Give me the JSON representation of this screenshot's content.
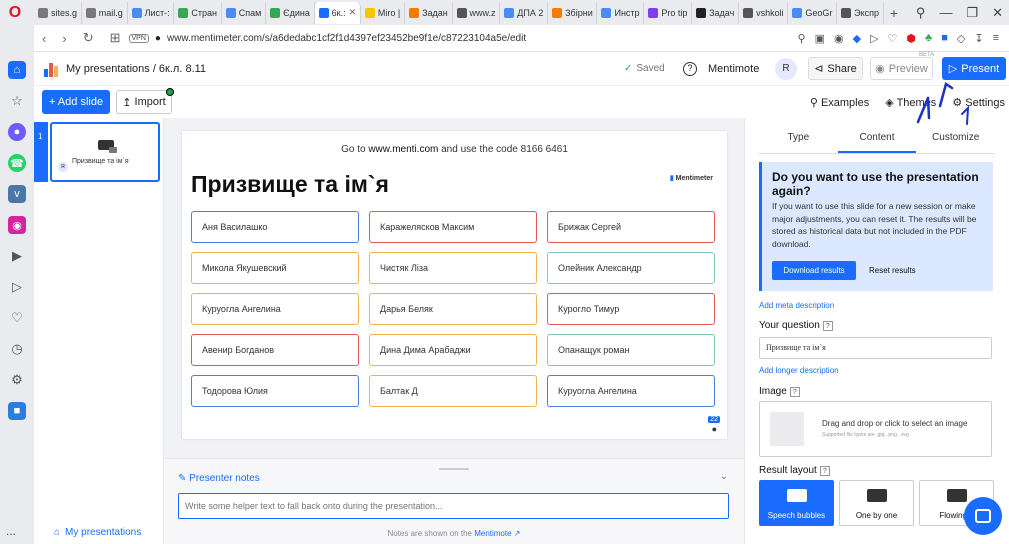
{
  "browser": {
    "tabs": [
      {
        "label": "sites.g",
        "color": "#7a7a7a"
      },
      {
        "label": "mail.g",
        "color": "#7a7a7a"
      },
      {
        "label": "Лист-:",
        "color": "#4c8bf5"
      },
      {
        "label": "Стран",
        "color": "#34a853"
      },
      {
        "label": "Спам",
        "color": "#4c8bf5"
      },
      {
        "label": "Єдина",
        "color": "#34a853"
      },
      {
        "label": "6к.:",
        "color": "#196cff",
        "active": true
      },
      {
        "label": "Miro |",
        "color": "#f7c500"
      },
      {
        "label": "Задан",
        "color": "#f57c00"
      },
      {
        "label": "www.z",
        "color": "#555"
      },
      {
        "label": "ДПА 2",
        "color": "#4c8bf5"
      },
      {
        "label": "Збірни",
        "color": "#f57c00"
      },
      {
        "label": "Инстр",
        "color": "#4c8bf5"
      },
      {
        "label": "Pro tip",
        "color": "#7e3ff2"
      },
      {
        "label": "Задач",
        "color": "#222"
      },
      {
        "label": "vshkoli",
        "color": "#555"
      },
      {
        "label": "GeoGr",
        "color": "#4c8bf5"
      },
      {
        "label": "Экспр",
        "color": "#555"
      }
    ],
    "new_tab": "+",
    "url": "www.mentimeter.com/s/a6dedabc1cf2f1d4397ef23452be9f1e/c87223104a5e/edit",
    "vpn": "VPN"
  },
  "header": {
    "breadcrumb": "My presentations / 6к.л. 8.11",
    "saved": "Saved",
    "mentimote": "Mentimote",
    "avatar": "R",
    "share": "Share",
    "preview": "Preview",
    "beta": "BETA",
    "present": "Present"
  },
  "toolbar": {
    "add_slide": "+ Add slide",
    "import": "Import",
    "examples": "Examples",
    "themes": "Themes",
    "settings": "Settings"
  },
  "slidelist": {
    "thumb_number": "1",
    "thumb_label": "Призвище та ім`я",
    "thumb_avatar": "R",
    "my_presentations": "My presentations",
    "more": "..."
  },
  "slide": {
    "join_prefix": "Go to ",
    "join_site": "www.menti.com",
    "join_middle": " and use the code ",
    "join_code": "8166 6461",
    "title": "Призвище та ім`я",
    "brand": "Mentimeter",
    "counter": "22",
    "responses": [
      {
        "text": "Аня Василашко",
        "color": "#4a7fe0"
      },
      {
        "text": "Каражелясков Максим",
        "color": "#e05a5a"
      },
      {
        "text": "Брижак Сергей",
        "color": "#e05a5a"
      },
      {
        "text": "Микола Якушевский",
        "color": "#f2b24c"
      },
      {
        "text": "Чистяк Ліза",
        "color": "#f2b24c"
      },
      {
        "text": "Олейник Александр",
        "color": "#7cc8b8"
      },
      {
        "text": "Куруогла Ангелина",
        "color": "#f2b24c"
      },
      {
        "text": "Дарья Беляк",
        "color": "#f2b24c"
      },
      {
        "text": "Курогло Тимур",
        "color": "#e05a5a"
      },
      {
        "text": "Авенир Богданов",
        "color": "#e05a5a"
      },
      {
        "text": "Дина Дима Арабаджи",
        "color": "#f2b24c"
      },
      {
        "text": "Опанащук роман",
        "color": "#7cc8b8"
      },
      {
        "text": "Тодорова Юлия",
        "color": "#4a7fe0"
      },
      {
        "text": "Балтак Д",
        "color": "#f2b24c"
      },
      {
        "text": "Куруогла Ангелина",
        "color": "#4a7fe0"
      }
    ]
  },
  "notes": {
    "header": "Presenter notes",
    "placeholder": "Write some helper text to fall back onto during the presentation...",
    "footer_prefix": "Notes are shown on the ",
    "footer_link": "Mentimote"
  },
  "panel": {
    "tabs": [
      "Type",
      "Content",
      "Customize"
    ],
    "reset_title": "Do you want to use the presentation again?",
    "reset_text": "If you want to use this slide for a new session or make major adjustments, you can reset it. The results will be stored as historical data but not included in the PDF download.",
    "download_results": "Download results",
    "reset_results": "Reset results",
    "add_meta": "Add meta description",
    "your_question": "Your question",
    "question_value": "Призвище та ім`я",
    "add_longer": "Add longer description",
    "image": "Image",
    "image_drop": "Drag and drop or click to select an image",
    "image_types": "Supported file types are .jpg, .png, .svg",
    "result_layout": "Result layout",
    "layouts": [
      "Speech bubbles",
      "One by one",
      "Flowing g"
    ]
  },
  "colors": {
    "accent": "#196cff",
    "reset_box": "#dbe8ff"
  }
}
